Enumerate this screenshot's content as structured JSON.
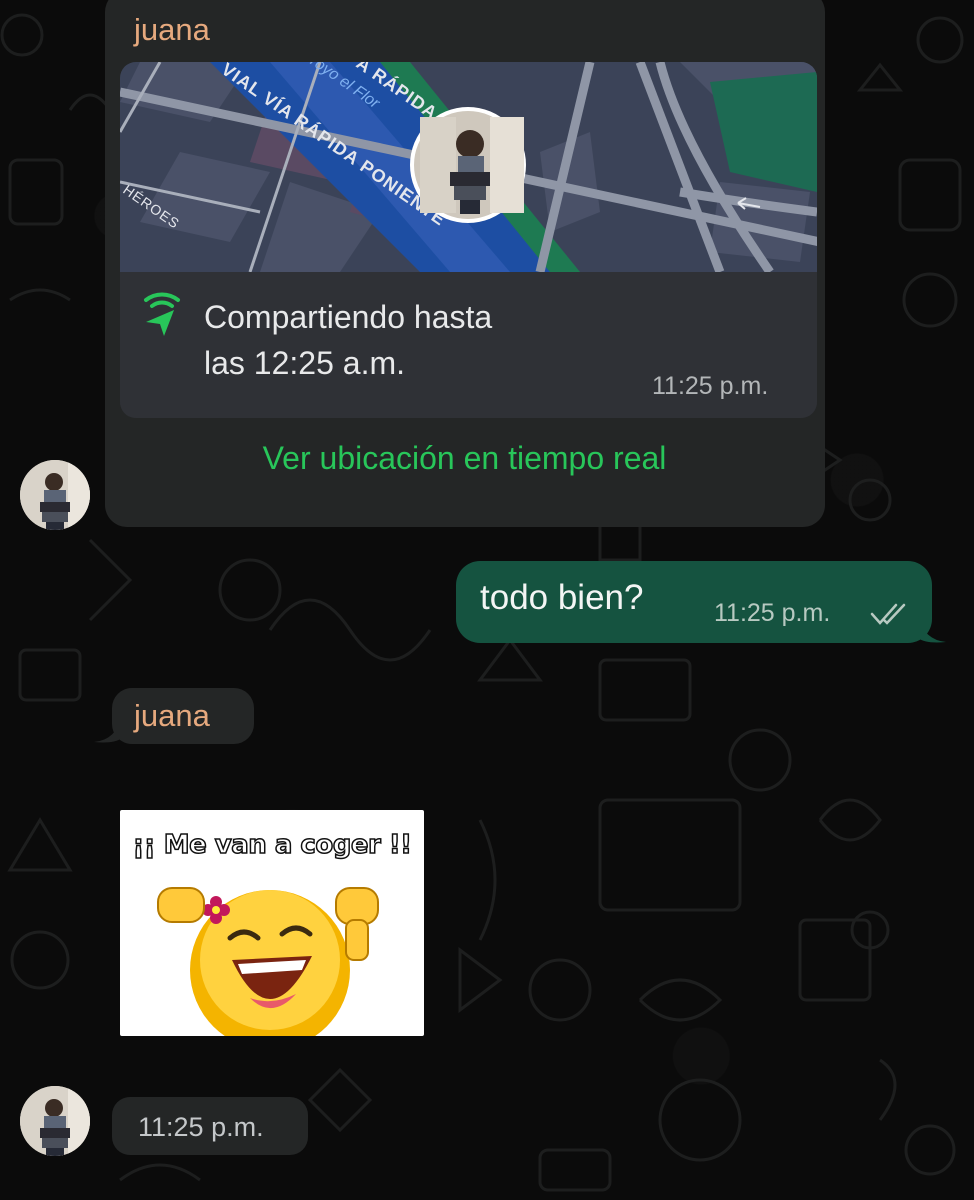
{
  "messages": {
    "location": {
      "sender": "juana",
      "map_street_1": "VIAL VÍA RÁPIDA PONIENTE",
      "map_street_2": "A RÁPIDA",
      "map_street_3": "rroyo el Flor",
      "map_street_4": "HÉROES",
      "share_line_1": "Compartiendo hasta",
      "share_line_2": "las 12:25 a.m.",
      "time": "11:25 p.m.",
      "action_label": "Ver ubicación en tiempo real"
    },
    "outgoing": {
      "text": "todo bien?",
      "time": "11:25 p.m.",
      "status_icon": "double-check-icon"
    },
    "sticker_message": {
      "sender": "juana",
      "sticker_caption": "¡¡ Me van a coger !!",
      "time": "11:25 p.m."
    }
  },
  "colors": {
    "background": "#0b0b0b",
    "incoming_bubble": "#242626",
    "outgoing_bubble": "#155340",
    "accent_green": "#28c65a",
    "sender_name": "#e6a97e"
  }
}
